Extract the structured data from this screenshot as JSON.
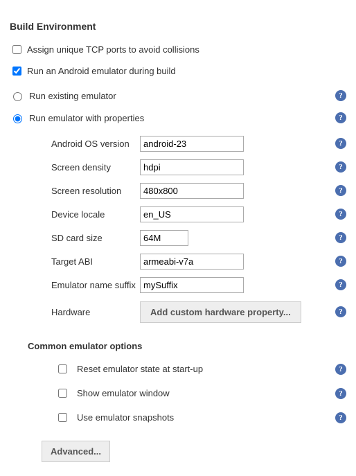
{
  "section": {
    "title": "Build Environment",
    "assign_ports_label": "Assign unique TCP ports to avoid collisions",
    "run_emulator_label": "Run an Android emulator during build"
  },
  "radios": {
    "existing": "Run existing emulator",
    "properties": "Run emulator with properties"
  },
  "props": {
    "os_version": {
      "label": "Android OS version",
      "value": "android-23"
    },
    "density": {
      "label": "Screen density",
      "value": "hdpi"
    },
    "resolution": {
      "label": "Screen resolution",
      "value": "480x800"
    },
    "locale": {
      "label": "Device locale",
      "value": "en_US"
    },
    "sdcard": {
      "label": "SD card size",
      "value": "64M"
    },
    "abi": {
      "label": "Target ABI",
      "value": "armeabi-v7a"
    },
    "suffix": {
      "label": "Emulator name suffix",
      "value": "mySuffix"
    },
    "hardware": {
      "label": "Hardware",
      "button": "Add custom hardware property..."
    }
  },
  "common": {
    "title": "Common emulator options",
    "reset": "Reset emulator state at start-up",
    "show": "Show emulator window",
    "snapshots": "Use emulator snapshots"
  },
  "advanced": "Advanced..."
}
